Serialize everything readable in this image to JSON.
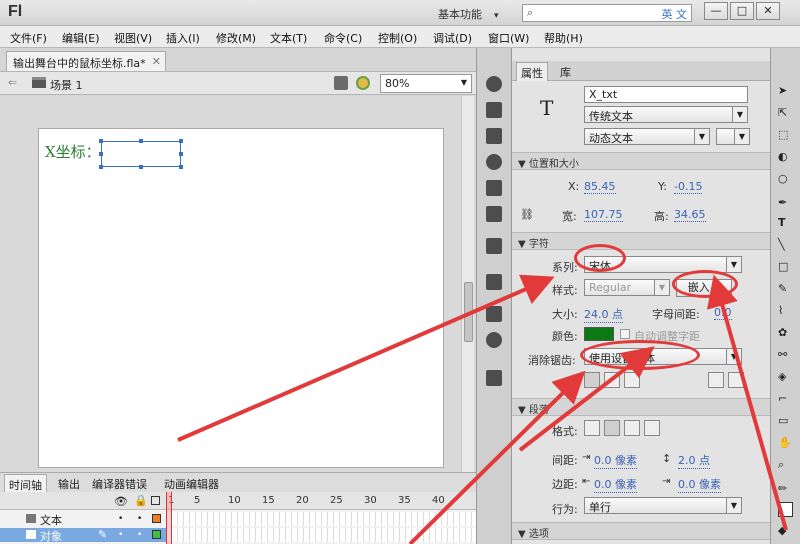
{
  "app": {
    "logo": "Fl",
    "workspace": "基本功能",
    "search_placeholder": "",
    "ime_label": "英 文",
    "minimize": "—",
    "maximize": "□",
    "close": "✕"
  },
  "menu": [
    "文件(F)",
    "编辑(E)",
    "视图(V)",
    "插入(I)",
    "修改(M)",
    "文本(T)",
    "命令(C)",
    "控制(O)",
    "调试(D)",
    "窗口(W)",
    "帮助(H)"
  ],
  "document": {
    "tab": "输出舞台中的鼠标坐标.fla*",
    "scene": "场景 1",
    "zoom": "80%",
    "stage_label": "X坐标："
  },
  "timeline": {
    "tabs": [
      "时间轴",
      "输出",
      "编译器错误",
      "动画编辑器"
    ],
    "frame_numbers": [
      "1",
      "5",
      "10",
      "15",
      "20",
      "25",
      "30",
      "35",
      "40"
    ],
    "layers": [
      {
        "name": "文本",
        "swatch": "#f07f22"
      },
      {
        "name": "对象",
        "swatch": "#44bb44"
      }
    ]
  },
  "properties": {
    "tabs": [
      "属性",
      "库"
    ],
    "instance_name": "X_txt",
    "text_engine": "传统文本",
    "text_type": "动态文本",
    "position_section": "位置和大小",
    "x_label": "X:",
    "x_value": "85.45",
    "y_label": "Y:",
    "y_value": "-0.15",
    "w_label": "宽:",
    "w_value": "107.75",
    "h_label": "高:",
    "h_value": "34.65",
    "char_section": "字符",
    "family_label": "系列:",
    "family_value": "宋体",
    "style_label": "样式:",
    "style_value": "Regular",
    "embed_button": "嵌入...",
    "size_label": "大小:",
    "size_value": "24.0 点",
    "spacing_label": "字母间距:",
    "spacing_value": "0.0",
    "color_label": "颜色:",
    "color_value": "#0b7a12",
    "auto_kern_label": "自动调整字距",
    "antialias_label": "消除锯齿:",
    "antialias_value": "使用设备字体",
    "para_section": "段落",
    "format_label": "格式:",
    "spacing2_label": "间距:",
    "indent_value": "0.0 像素",
    "line_spacing_value": "2.0 点",
    "margin_label": "边距:",
    "margin_left": "0.0 像素",
    "margin_right": "0.0 像素",
    "behavior_label": "行为:",
    "behavior_value": "单行",
    "options_section": "选项"
  }
}
